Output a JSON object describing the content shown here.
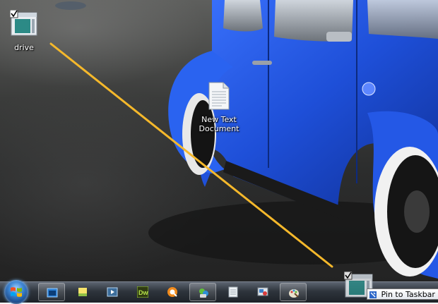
{
  "desktop": {
    "icons": [
      {
        "label": "drive",
        "icon": "program-window-icon"
      },
      {
        "label": "New Text\nDocument",
        "icon": "text-document-icon"
      }
    ]
  },
  "drag": {
    "tooltip": "Pin to Taskbar",
    "color": "#f5b82b"
  },
  "taskbar": {
    "start": "windows-start-orb",
    "items": [
      "internet-explorer-icon",
      "sticky-notes-icon",
      "media-player-icon",
      "dreamweaver-icon",
      "quicktime-icon",
      "msn-messenger-icon",
      "notepad-icon",
      "remote-desktop-icon",
      "paint-icon"
    ]
  },
  "colors": {
    "car": "#1e4fd8",
    "taskbar": "#2e343c"
  }
}
